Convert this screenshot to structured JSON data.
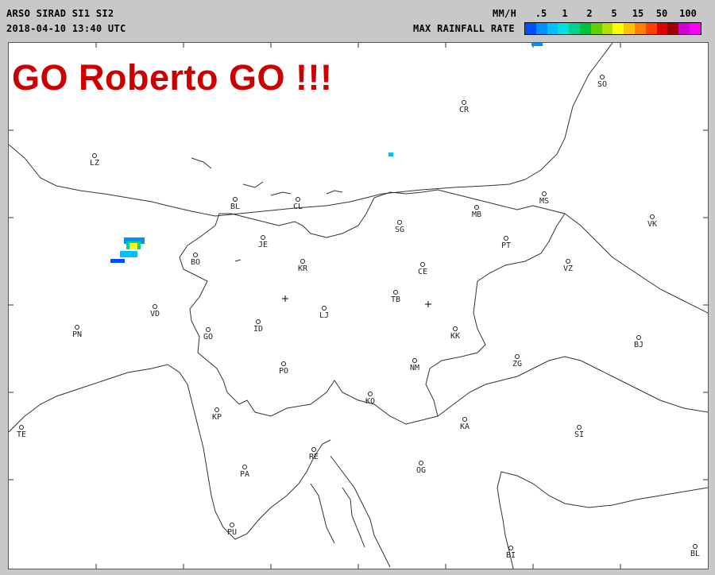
{
  "header": {
    "line1": "ARSO SIRAD SI1 SI2",
    "line2": "2018-04-10 13:40 UTC",
    "unit_label": "MM/H",
    "rate_label": "MAX RAINFALL RATE"
  },
  "legend": {
    "ticks": [
      ".5",
      "1",
      "2",
      "5",
      "15",
      "50",
      "100"
    ],
    "colors": [
      "#0050ff",
      "#0090ff",
      "#00c0ff",
      "#00e0e0",
      "#00d090",
      "#00c040",
      "#60d000",
      "#b0e000",
      "#ffff00",
      "#ffc000",
      "#ff8000",
      "#ff4000",
      "#e00000",
      "#a00000",
      "#d000d0",
      "#ff00ff"
    ]
  },
  "banner": "GO Roberto GO !!!",
  "cities": [
    {
      "code": "CR"
    },
    {
      "code": "SO"
    },
    {
      "code": "LZ"
    },
    {
      "code": "BL"
    },
    {
      "code": "CL"
    },
    {
      "code": "MB"
    },
    {
      "code": "MS"
    },
    {
      "code": "SG"
    },
    {
      "code": "VK"
    },
    {
      "code": "JE"
    },
    {
      "code": "PT"
    },
    {
      "code": "BO"
    },
    {
      "code": "KR"
    },
    {
      "code": "CE"
    },
    {
      "code": "VZ"
    },
    {
      "code": "TB"
    },
    {
      "code": "VD"
    },
    {
      "code": "LJ"
    },
    {
      "code": "PN"
    },
    {
      "code": "ID"
    },
    {
      "code": "GO"
    },
    {
      "code": "KK"
    },
    {
      "code": "BJ"
    },
    {
      "code": "ZG"
    },
    {
      "code": "PO"
    },
    {
      "code": "NM"
    },
    {
      "code": "KO"
    },
    {
      "code": "KP"
    },
    {
      "code": "KA"
    },
    {
      "code": "TE"
    },
    {
      "code": "SI"
    },
    {
      "code": "RE"
    },
    {
      "code": "PA"
    },
    {
      "code": "OG"
    },
    {
      "code": "PU"
    },
    {
      "code": "BI"
    },
    {
      "code": "BL"
    }
  ]
}
